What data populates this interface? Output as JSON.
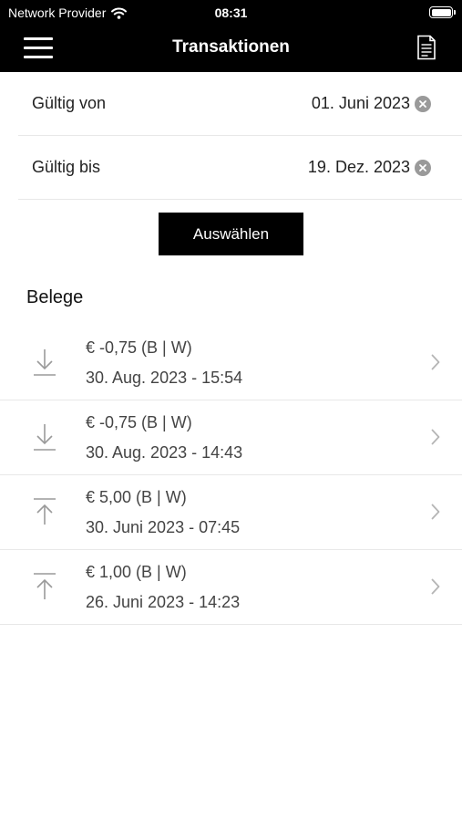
{
  "status_bar": {
    "carrier": "Network Provider",
    "time": "08:31"
  },
  "nav": {
    "title": "Transaktionen",
    "menu_icon": "hamburger-menu-icon",
    "action_icon": "document-icon"
  },
  "filters": {
    "from_label": "Gültig von",
    "from_value": "01. Juni 2023",
    "to_label": "Gültig bis",
    "to_value": "19. Dez. 2023",
    "select_button": "Auswählen"
  },
  "receipts": {
    "title": "Belege",
    "items": [
      {
        "amount": "€ -0,75 (B | W)",
        "date": "30. Aug. 2023 - 15:54",
        "direction": "down",
        "icon": "arrow-down-to-line-icon"
      },
      {
        "amount": "€ -0,75 (B | W)",
        "date": "30. Aug. 2023 - 14:43",
        "direction": "down",
        "icon": "arrow-down-to-line-icon"
      },
      {
        "amount": "€ 5,00 (B | W)",
        "date": "30. Juni 2023 - 07:45",
        "direction": "up",
        "icon": "arrow-up-from-line-icon"
      },
      {
        "amount": "€ 1,00 (B | W)",
        "date": "26. Juni 2023 - 14:23",
        "direction": "up",
        "icon": "arrow-up-from-line-icon"
      }
    ]
  },
  "colors": {
    "bar_background": "#000000",
    "icon_gray": "#9a9a9a",
    "text": "#444444"
  }
}
